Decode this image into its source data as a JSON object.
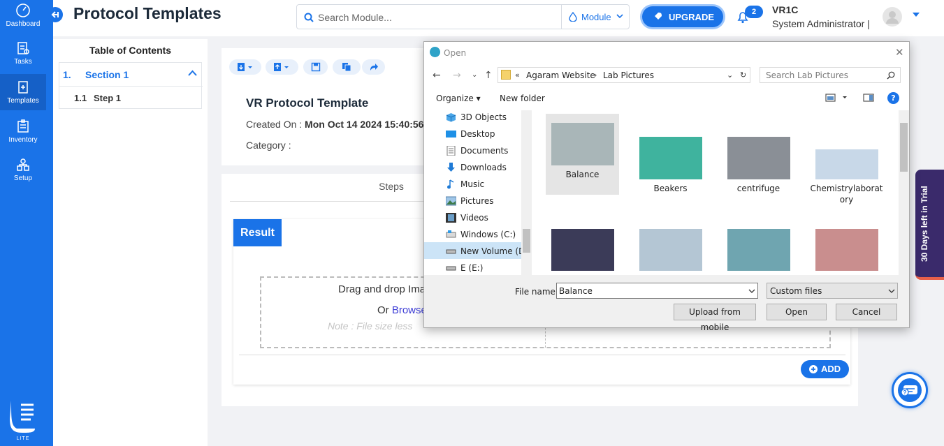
{
  "nav": {
    "items": [
      {
        "label": "Dashboard"
      },
      {
        "label": "Tasks"
      },
      {
        "label": "Templates"
      },
      {
        "label": "Inventory"
      },
      {
        "label": "Setup"
      }
    ],
    "logo_text": "LITE"
  },
  "header": {
    "title": "Protocol Templates",
    "search_placeholder": "Search Module...",
    "module_label": "Module",
    "upgrade_label": "UPGRADE",
    "notification_count": "2",
    "user_name": "VR1C",
    "user_role": "System Administrator |"
  },
  "toc": {
    "title": "Table of Contents",
    "section_number": "1.",
    "section_label": "Section 1",
    "step_number": "1.1",
    "step_label": "Step 1"
  },
  "template": {
    "title": "VR Protocol Template",
    "created_label": "Created On :",
    "created_value": "Mon Oct 14 2024 15:40:56",
    "category_label": "Category :"
  },
  "steps": {
    "tab_label": "Steps",
    "result_label": "Result",
    "drop_text": "Drag and drop Ima",
    "or_text": "Or ",
    "browse_text": "Browse",
    "note_text": "Note : File size less"
  },
  "add_label": "ADD",
  "trial_label": "30 Days left in Trial",
  "dialog": {
    "title": "Open",
    "path": [
      "Agaram Website",
      "Lab Pictures"
    ],
    "search_placeholder": "Search Lab Pictures",
    "organize_label": "Organize",
    "new_folder_label": "New folder",
    "tree": [
      {
        "label": "3D Objects",
        "icon": "cube-icon"
      },
      {
        "label": "Desktop",
        "icon": "desktop-icon"
      },
      {
        "label": "Documents",
        "icon": "documents-icon"
      },
      {
        "label": "Downloads",
        "icon": "download-icon"
      },
      {
        "label": "Music",
        "icon": "music-icon"
      },
      {
        "label": "Pictures",
        "icon": "pictures-icon"
      },
      {
        "label": "Videos",
        "icon": "videos-icon"
      },
      {
        "label": "Windows (C:)",
        "icon": "drive-icon"
      },
      {
        "label": "New Volume (D:",
        "icon": "drive-icon"
      },
      {
        "label": "E (E:)",
        "icon": "drive-icon"
      }
    ],
    "files": [
      {
        "label": "Balance",
        "color": "#a9b6b8"
      },
      {
        "label": "Beakers",
        "color": "#3fb39e"
      },
      {
        "label": "centrifuge",
        "color": "#8a8f96"
      },
      {
        "label": "Chemistrylaborat ory",
        "color": "#c8d8e8"
      },
      {
        "label": "",
        "color": "#3b3b58"
      },
      {
        "label": "",
        "color": "#b4c6d4"
      },
      {
        "label": "",
        "color": "#6fa5b0"
      },
      {
        "label": "",
        "color": "#c98e8e"
      }
    ],
    "filename_label": "File name:",
    "filename_value": "Balance",
    "filetype_value": "Custom files",
    "upload_mobile_label": "Upload from mobile",
    "open_label": "Open",
    "cancel_label": "Cancel"
  }
}
